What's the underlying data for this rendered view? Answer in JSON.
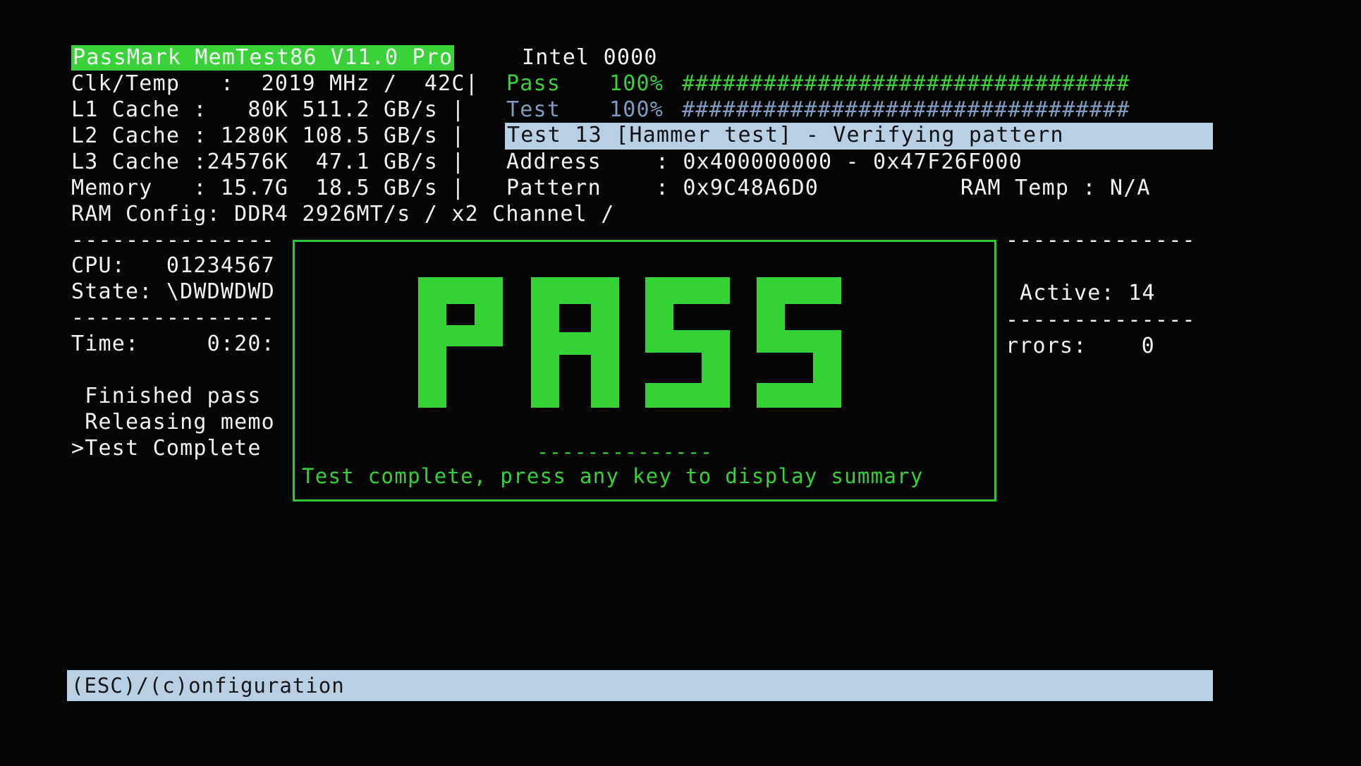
{
  "header": {
    "product": "PassMark MemTest86 V11.0 Pro",
    "cpu_vendor": "Intel 0000"
  },
  "stats": {
    "clk_temp": "Clk/Temp   :  2019 MHz /  42C|",
    "l1": "L1 Cache :   80K 511.2 GB/s |",
    "l2": "L2 Cache : 1280K 108.5 GB/s |",
    "l3": "L3 Cache :24576K  47.1 GB/s |",
    "memory": "Memory   : 15.7G  18.5 GB/s |",
    "ram_config": "RAM Config: DDR4 2926MT/s / x2 Channel /"
  },
  "progress": {
    "pass_label": "Pass",
    "pass_percent": "100%",
    "pass_bar": "#################################",
    "pass_value": 1.0,
    "test_label": "Test",
    "test_percent": "100%",
    "test_bar": "#################################",
    "test_value": 1.0
  },
  "current_test": {
    "title": "Test 13 [Hammer test] - Verifying pattern",
    "address": "Address    : 0x400000000 - 0x47F26F000",
    "pattern": "Pattern    : 0x9C48A6D0",
    "ram_temp": "RAM Temp : N/A"
  },
  "left_panel": {
    "dash1": "---------------",
    "cpu": "CPU:   01234567",
    "state": "State: \\DWDWDWD",
    "dash2": "---------------",
    "time": "Time:     0:20:",
    "log1": " Finished pass",
    "log2": " Releasing memo",
    "log3": ">Test Complete"
  },
  "right_panel": {
    "dash1": "--------------",
    "active": "Active: 14",
    "dash2": "--------------",
    "errors": "rrors:    0"
  },
  "popup": {
    "big_text": "PASS",
    "dashes": "--------------",
    "message": "Test complete, press any key to display summary"
  },
  "footer": {
    "text": "(ESC)/(c)onfiguration"
  },
  "colors": {
    "accent_green": "#35d235",
    "highlight_blue": "#b9cfe2",
    "dim_blue": "#7f9cc0"
  }
}
